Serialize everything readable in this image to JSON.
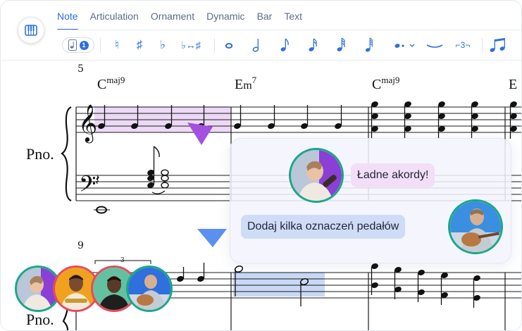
{
  "tabs": [
    {
      "label": "Note",
      "active": true
    },
    {
      "label": "Articulation",
      "active": false
    },
    {
      "label": "Ornament",
      "active": false
    },
    {
      "label": "Dynamic",
      "active": false
    },
    {
      "label": "Bar",
      "active": false
    },
    {
      "label": "Text",
      "active": false
    }
  ],
  "toolbar": {
    "voice_badge": "1",
    "natural": "♮",
    "sharp": "♯",
    "flat": "♭",
    "enharmonic": "♭↔♯",
    "tuplet": "⌐3¬",
    "accent_color": "#2f6fde",
    "icons": [
      "piano-keys-icon",
      "voice-note-icon",
      "natural-icon",
      "sharp-icon",
      "flat-icon",
      "enharmonic-icon",
      "whole-note-icon",
      "half-note-icon",
      "quarter-note-icon",
      "eighth-note-icon",
      "sixteenth-note-icon",
      "thirty-second-note-icon",
      "dot-icon",
      "tie-icon",
      "tuplet-icon",
      "beamed-notes-icon"
    ]
  },
  "score": {
    "measure_numbers": [
      "5",
      "9"
    ],
    "chords": [
      {
        "root": "C",
        "ext": "maj9"
      },
      {
        "root": "E",
        "mid": "m",
        "ext": "7"
      },
      {
        "root": "C",
        "ext": "maj9"
      },
      {
        "root": "E",
        "ext": ""
      }
    ],
    "instrument": "Pno.",
    "tuplet_number": "3"
  },
  "comments": [
    {
      "text": "Ładne akordy!",
      "color": "#f2def6",
      "avatar_ring": "#1aa886"
    },
    {
      "text": "Dodaj kilka oznaczeń pedałów",
      "color": "#cfdcf6",
      "avatar_ring": "#1aa886"
    }
  ],
  "selection_colors": {
    "pink": "#ecd9f6",
    "blue": "#c9d8f5",
    "cursor_purple": "#a54fe0",
    "cursor_blue": "#5b8ff0"
  },
  "collaborators": [
    {
      "ring": "#1aa886",
      "bg": "#8a3fd6"
    },
    {
      "ring": "#e64a5b",
      "bg": "#f0a21e"
    },
    {
      "ring": "#e64a5b",
      "bg": "#63c1a2"
    },
    {
      "ring": "#1aa886",
      "bg": "#2f6fde"
    }
  ]
}
